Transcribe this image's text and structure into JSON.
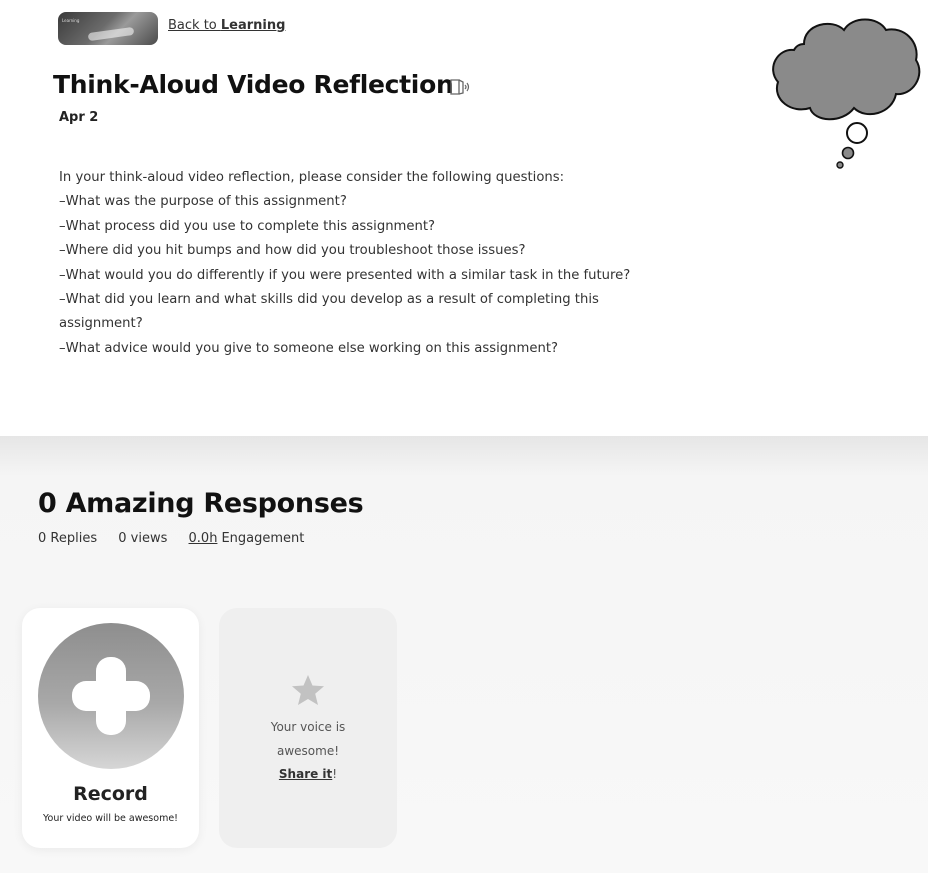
{
  "header": {
    "thumbnail_caption": "Learning",
    "back_link_prefix": "Back to ",
    "back_link_target": "Learning"
  },
  "assignment": {
    "title": "Think-Aloud Video Reflection",
    "date": "Apr 2",
    "prompt_lines": [
      "In your think-aloud video reflection, please consider the following questions:",
      "–What was the purpose of this assignment?",
      "–What process did you use to complete this assignment?",
      "–Where did you hit bumps and how did you troubleshoot those issues?",
      "–What would you do differently if you were presented with a similar task in the future?",
      "–What did you learn and what skills did you develop as a result of completing this",
      "assignment?",
      "–What advice would you give to someone else working on this assignment?"
    ],
    "reader_icon": "immersive-reader-icon",
    "decoration_icon": "thought-bubble-icon"
  },
  "responses": {
    "title": "0 Amazing Responses",
    "replies": "0 Replies",
    "views": "0 views",
    "engagement_value": "0.0h",
    "engagement_label": "Engagement"
  },
  "record_card": {
    "icon": "plus-icon",
    "label": "Record",
    "subtitle": "Your video will be awesome!"
  },
  "share_card": {
    "icon": "star-icon",
    "line1": "Your voice is",
    "line2": "awesome!",
    "link": "Share it",
    "suffix": "!"
  },
  "colors": {
    "text_dark": "#111111",
    "text_body": "#333333",
    "bubble_fill": "#8a8a8a",
    "record_circle": "#a0a0a0",
    "share_card_bg": "#efefef",
    "section_bg": "#f8f8f8"
  }
}
